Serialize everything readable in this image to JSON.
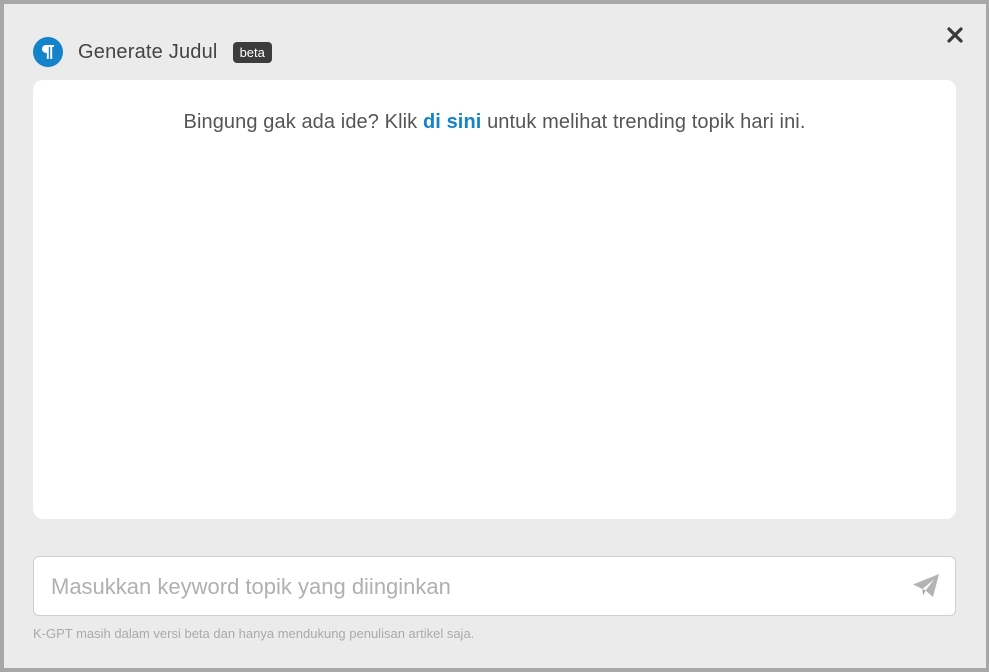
{
  "modal": {
    "title": "Generate Judul",
    "badge": "beta",
    "logo_icon": "paragraph-icon",
    "close_icon": "close-icon"
  },
  "content": {
    "hint_before": "Bingung gak ada ide? Klik ",
    "hint_link": "di sini",
    "hint_after": " untuk melihat trending topik hari ini."
  },
  "input": {
    "value": "",
    "placeholder": "Masukkan keyword topik yang diinginkan",
    "send_icon": "send-icon"
  },
  "footnote": "K-GPT masih dalam versi beta dan hanya mendukung penulisan artikel saja.",
  "colors": {
    "accent": "#1583c9",
    "badge_bg": "#3c3c3c",
    "modal_bg": "#ebebeb"
  }
}
